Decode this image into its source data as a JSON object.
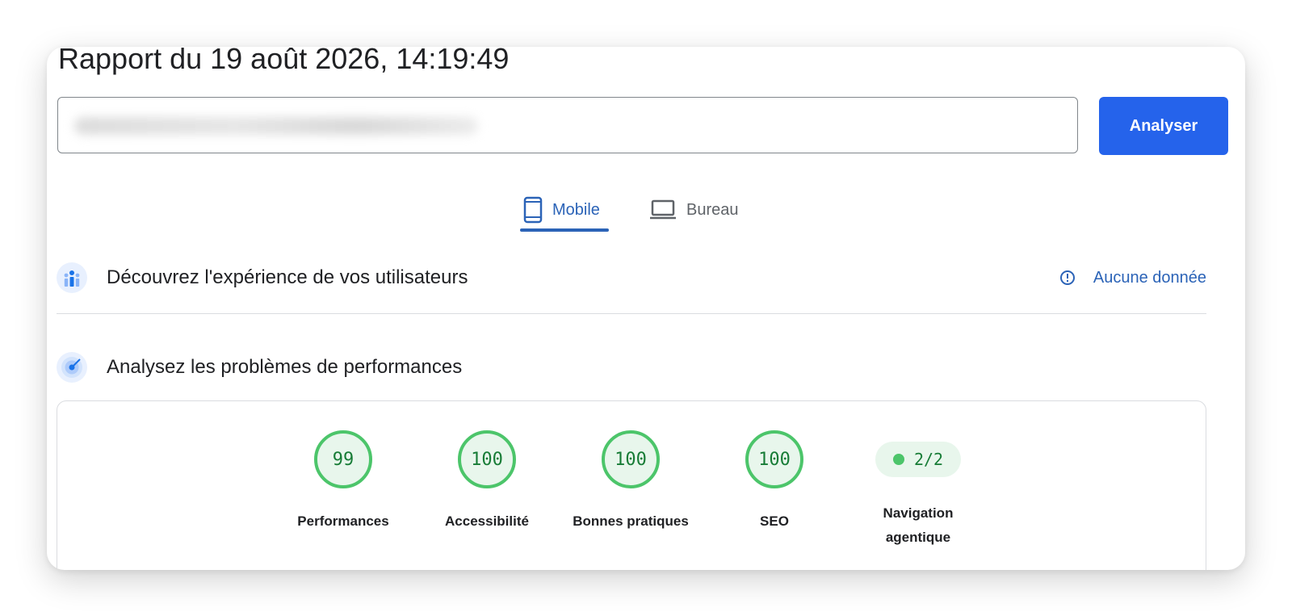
{
  "header": {
    "title": "Rapport du 19 août 2026, 14:19:49"
  },
  "search": {
    "placeholder": "",
    "analyze_label": "Analyser"
  },
  "tabs": [
    {
      "label": "Mobile",
      "icon": "phone-icon",
      "active": true
    },
    {
      "label": "Bureau",
      "icon": "laptop-icon",
      "active": false
    }
  ],
  "sections": {
    "users": {
      "title": "Découvrez l'expérience de vos utilisateurs",
      "status": "Aucune donnée",
      "icon": "users-chart-icon"
    },
    "perf": {
      "title": "Analysez les problèmes de performances",
      "icon": "radar-icon"
    }
  },
  "scores": [
    {
      "value": "99",
      "label": "Performances"
    },
    {
      "value": "100",
      "label": "Accessibilité"
    },
    {
      "value": "100",
      "label": "Bonnes pratiques"
    },
    {
      "value": "100",
      "label": "SEO"
    }
  ],
  "agentic": {
    "value": "2/2",
    "label": "Navigation agentique"
  },
  "colors": {
    "accent": "#2563eb",
    "tab_active": "#2b63b7",
    "pass": "#4cc56a",
    "pass_text": "#177c36"
  }
}
